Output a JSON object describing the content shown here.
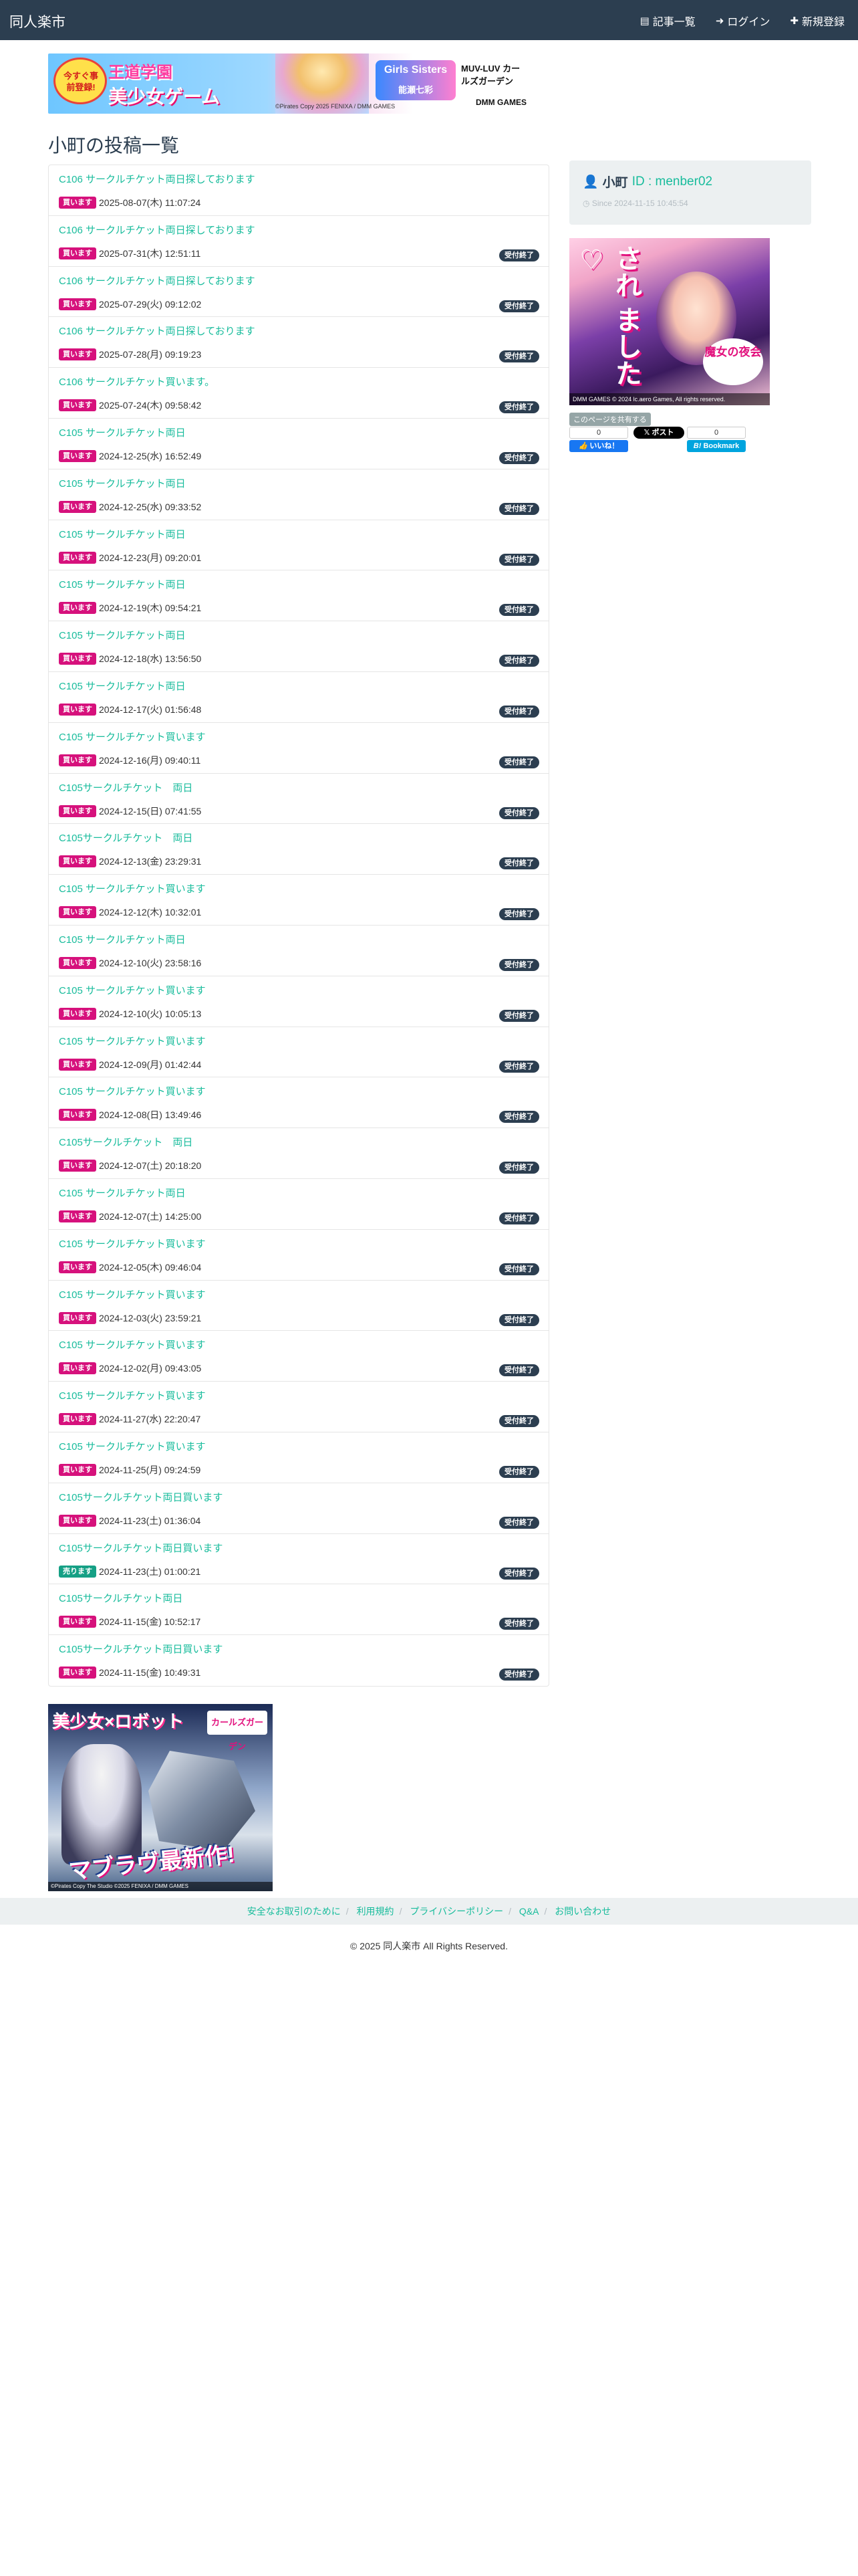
{
  "nav": {
    "brand": "同人楽市",
    "links": [
      "記事一覧",
      "ログイン",
      "新規登録"
    ],
    "icons": [
      "list-icon",
      "login-icon",
      "plus-icon"
    ]
  },
  "top_banner": {
    "badge": "今すぐ事前登録!",
    "headline1": "王道学園",
    "headline2": "美少女ゲーム",
    "middle": "Girls Sisters",
    "character": "能瀬七彩",
    "game": "MUV-LUV カールズガーデン",
    "publisher": "DMM GAMES",
    "copyright": "©Pirates Copy 2025 FENIXA / DMM GAMES"
  },
  "page_title": "小町の投稿一覧",
  "posts": [
    {
      "title": "C106 サークルチケット両日探しております",
      "tag": "買います",
      "tag_type": "buy",
      "date": "2025-08-07(木) 11:07:24",
      "status": ""
    },
    {
      "title": "C106 サークルチケット両日探しております",
      "tag": "買います",
      "tag_type": "buy",
      "date": "2025-07-31(木) 12:51:11",
      "status": "受付終了"
    },
    {
      "title": "C106 サークルチケット両日探しております",
      "tag": "買います",
      "tag_type": "buy",
      "date": "2025-07-29(火) 09:12:02",
      "status": "受付終了"
    },
    {
      "title": "C106 サークルチケット両日探しております",
      "tag": "買います",
      "tag_type": "buy",
      "date": "2025-07-28(月) 09:19:23",
      "status": "受付終了"
    },
    {
      "title": "C106 サークルチケット買います。",
      "tag": "買います",
      "tag_type": "buy",
      "date": "2025-07-24(木) 09:58:42",
      "status": "受付終了"
    },
    {
      "title": "C105 サークルチケット両日",
      "tag": "買います",
      "tag_type": "buy",
      "date": "2024-12-25(水) 16:52:49",
      "status": "受付終了"
    },
    {
      "title": "C105 サークルチケット両日",
      "tag": "買います",
      "tag_type": "buy",
      "date": "2024-12-25(水) 09:33:52",
      "status": "受付終了"
    },
    {
      "title": "C105 サークルチケット両日",
      "tag": "買います",
      "tag_type": "buy",
      "date": "2024-12-23(月) 09:20:01",
      "status": "受付終了"
    },
    {
      "title": "C105 サークルチケット両日",
      "tag": "買います",
      "tag_type": "buy",
      "date": "2024-12-19(木) 09:54:21",
      "status": "受付終了"
    },
    {
      "title": "C105 サークルチケット両日",
      "tag": "買います",
      "tag_type": "buy",
      "date": "2024-12-18(水) 13:56:50",
      "status": "受付終了"
    },
    {
      "title": "C105 サークルチケット両日",
      "tag": "買います",
      "tag_type": "buy",
      "date": "2024-12-17(火) 01:56:48",
      "status": "受付終了"
    },
    {
      "title": "C105 サークルチケット買います",
      "tag": "買います",
      "tag_type": "buy",
      "date": "2024-12-16(月) 09:40:11",
      "status": "受付終了"
    },
    {
      "title": "C105サークルチケット　両日",
      "tag": "買います",
      "tag_type": "buy",
      "date": "2024-12-15(日) 07:41:55",
      "status": "受付終了"
    },
    {
      "title": "C105サークルチケット　両日",
      "tag": "買います",
      "tag_type": "buy",
      "date": "2024-12-13(金) 23:29:31",
      "status": "受付終了"
    },
    {
      "title": "C105 サークルチケット買います",
      "tag": "買います",
      "tag_type": "buy",
      "date": "2024-12-12(木) 10:32:01",
      "status": "受付終了"
    },
    {
      "title": "C105 サークルチケット両日",
      "tag": "買います",
      "tag_type": "buy",
      "date": "2024-12-10(火) 23:58:16",
      "status": "受付終了"
    },
    {
      "title": "C105 サークルチケット買います",
      "tag": "買います",
      "tag_type": "buy",
      "date": "2024-12-10(火) 10:05:13",
      "status": "受付終了"
    },
    {
      "title": "C105 サークルチケット買います",
      "tag": "買います",
      "tag_type": "buy",
      "date": "2024-12-09(月) 01:42:44",
      "status": "受付終了"
    },
    {
      "title": "C105 サークルチケット買います",
      "tag": "買います",
      "tag_type": "buy",
      "date": "2024-12-08(日) 13:49:46",
      "status": "受付終了"
    },
    {
      "title": "C105サークルチケット　両日",
      "tag": "買います",
      "tag_type": "buy",
      "date": "2024-12-07(土) 20:18:20",
      "status": "受付終了"
    },
    {
      "title": "C105 サークルチケット両日",
      "tag": "買います",
      "tag_type": "buy",
      "date": "2024-12-07(土) 14:25:00",
      "status": "受付終了"
    },
    {
      "title": "C105 サークルチケット買います",
      "tag": "買います",
      "tag_type": "buy",
      "date": "2024-12-05(木) 09:46:04",
      "status": "受付終了"
    },
    {
      "title": "C105 サークルチケット買います",
      "tag": "買います",
      "tag_type": "buy",
      "date": "2024-12-03(火) 23:59:21",
      "status": "受付終了"
    },
    {
      "title": "C105 サークルチケット買います",
      "tag": "買います",
      "tag_type": "buy",
      "date": "2024-12-02(月) 09:43:05",
      "status": "受付終了"
    },
    {
      "title": "C105 サークルチケット買います",
      "tag": "買います",
      "tag_type": "buy",
      "date": "2024-11-27(水) 22:20:47",
      "status": "受付終了"
    },
    {
      "title": "C105 サークルチケット買います",
      "tag": "買います",
      "tag_type": "buy",
      "date": "2024-11-25(月) 09:24:59",
      "status": "受付終了"
    },
    {
      "title": "C105サークルチケット両日買います",
      "tag": "買います",
      "tag_type": "buy",
      "date": "2024-11-23(土) 01:36:04",
      "status": "受付終了"
    },
    {
      "title": "C105サークルチケット両日買います",
      "tag": "売ります",
      "tag_type": "sell",
      "date": "2024-11-23(土) 01:00:21",
      "status": "受付終了"
    },
    {
      "title": "C105サークルチケット両日",
      "tag": "買います",
      "tag_type": "buy",
      "date": "2024-11-15(金) 10:52:17",
      "status": "受付終了"
    },
    {
      "title": "C105サークルチケット両日買います",
      "tag": "買います",
      "tag_type": "buy",
      "date": "2024-11-15(金) 10:49:31",
      "status": "受付終了"
    }
  ],
  "profile": {
    "name": "小町",
    "id_label": "ID : menber02",
    "since": "Since 2024-11-15 10:45:54"
  },
  "side_ad": {
    "headline": "され ました♡",
    "badge": "魔女の夜会",
    "footer": "DMM GAMES  © 2024 lc.aero Games, All rights reserved."
  },
  "share": {
    "label": "このページを共有する",
    "facebook_count": "0",
    "facebook_label": "いいね！",
    "x_label": "ポスト",
    "hatena_count": "0",
    "hatena_label": "Bookmark"
  },
  "bottom_banner": {
    "headline": "美少女×ロボット",
    "logo": "カールズガーデン",
    "tagline": "マブラヴ最新作!",
    "footer": "©Pirates Copy The Studio ©2025 FENIXA / DMM GAMES"
  },
  "footer": {
    "links": [
      "安全なお取引のために",
      "利用規約",
      "プライバシーポリシー",
      "Q&A",
      "お問い合わせ"
    ],
    "copyright": "© 2025 同人楽市 All Rights Reserved."
  },
  "colors": {
    "navbar": "#2c3e50",
    "link": "#18bc9c",
    "buy_tag": "#d6117c",
    "sell_tag": "#15a085",
    "done_badge": "#2c3e50"
  }
}
